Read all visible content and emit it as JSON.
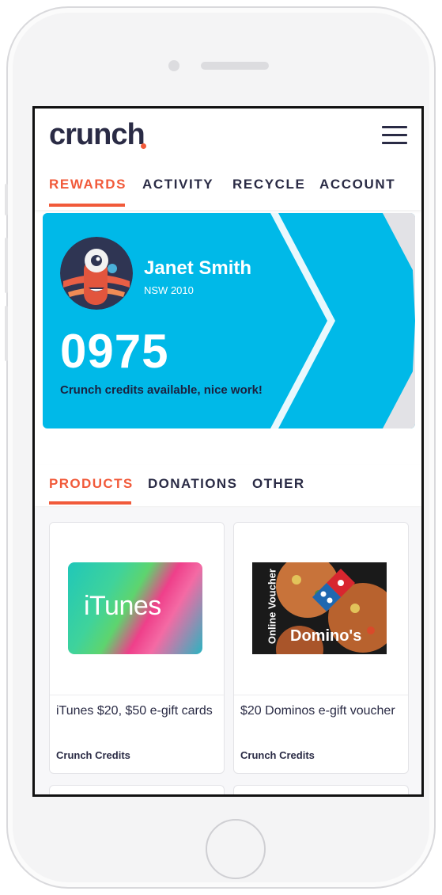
{
  "app": {
    "logo_text": "crunch",
    "menu_icon": "hamburger-menu-icon"
  },
  "nav": {
    "tabs": [
      {
        "label": "REWARDS",
        "active": true
      },
      {
        "label": "ACTIVITY",
        "active": false
      },
      {
        "label": "RECYCLE",
        "active": false
      },
      {
        "label": "ACCOUNT",
        "active": false
      }
    ]
  },
  "profile": {
    "name": "Janet Smith",
    "location": "NSW 2010",
    "credits": "0975",
    "credits_label": "Crunch credits available, nice work!"
  },
  "product_tabs": [
    {
      "label": "PRODUCTS",
      "active": true
    },
    {
      "label": "DONATIONS",
      "active": false
    },
    {
      "label": "OTHER",
      "active": false
    }
  ],
  "products": [
    {
      "title": "iTunes $20, $50 e-gift cards",
      "price_label": "Crunch Credits",
      "image_text": " iTunes"
    },
    {
      "title": "$20 Dominos e-gift voucher",
      "price_label": "Crunch Credits",
      "image_text": "Domino's",
      "image_side_text": "Online Voucher"
    }
  ],
  "colors": {
    "accent": "#f15a3a",
    "card_blue": "#00b9e8",
    "text_dark": "#2a2b45"
  }
}
